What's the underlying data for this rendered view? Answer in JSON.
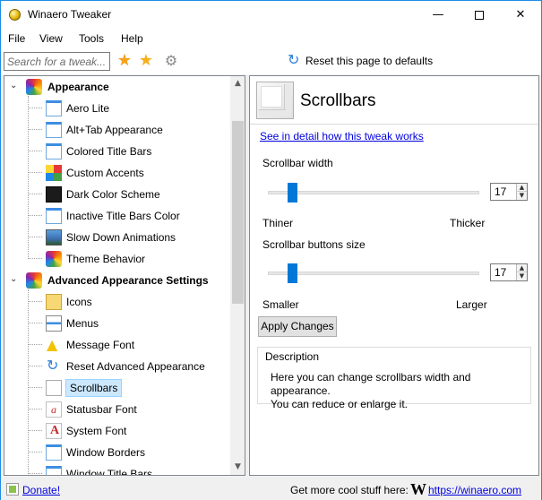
{
  "window": {
    "title": "Winaero Tweaker",
    "minimize": "—",
    "close": "✕"
  },
  "menu": [
    "File",
    "View",
    "Tools",
    "Help"
  ],
  "toolbar": {
    "search_placeholder": "Search for a tweak...",
    "reset_label": "Reset this page to defaults"
  },
  "tree": {
    "groups": [
      {
        "label": "Appearance",
        "icon": "rainbow-icon",
        "items": [
          {
            "label": "Aero Lite",
            "icon": "window-icon"
          },
          {
            "label": "Alt+Tab Appearance",
            "icon": "window-icon"
          },
          {
            "label": "Colored Title Bars",
            "icon": "window-icon"
          },
          {
            "label": "Custom Accents",
            "icon": "mosaic-icon"
          },
          {
            "label": "Dark Color Scheme",
            "icon": "dark-icon"
          },
          {
            "label": "Inactive Title Bars Color",
            "icon": "window-icon"
          },
          {
            "label": "Slow Down Animations",
            "icon": "landscape-icon"
          },
          {
            "label": "Theme Behavior",
            "icon": "rainbow-icon"
          }
        ]
      },
      {
        "label": "Advanced Appearance Settings",
        "icon": "rainbow-icon",
        "items": [
          {
            "label": "Icons",
            "icon": "folder-icon"
          },
          {
            "label": "Menus",
            "icon": "menu-icon"
          },
          {
            "label": "Message Font",
            "icon": "warning-icon"
          },
          {
            "label": "Reset Advanced Appearance",
            "icon": "refresh-icon"
          },
          {
            "label": "Scrollbars",
            "icon": "scrollbar-icon",
            "selected": true
          },
          {
            "label": "Statusbar Font",
            "icon": "font-icon"
          },
          {
            "label": "System Font",
            "icon": "font-icon"
          },
          {
            "label": "Window Borders",
            "icon": "window-icon"
          },
          {
            "label": "Window Title Bars",
            "icon": "window-icon"
          }
        ]
      }
    ]
  },
  "page": {
    "title": "Scrollbars",
    "detail_link": "See in detail how this tweak works",
    "width_label": "Scrollbar width",
    "width_value": "17",
    "width_min_label": "Thiner",
    "width_max_label": "Thicker",
    "buttons_label": "Scrollbar buttons size",
    "buttons_value": "17",
    "buttons_min_label": "Smaller",
    "buttons_max_label": "Larger",
    "apply_label": "Apply Changes",
    "description_title": "Description",
    "description_line1": "Here you can change scrollbars width and appearance.",
    "description_line2": "You can reduce or enlarge it."
  },
  "status": {
    "donate": "Donate!",
    "text": "Get more cool stuff here:",
    "logo": "W",
    "site": "https://winaero.com"
  }
}
